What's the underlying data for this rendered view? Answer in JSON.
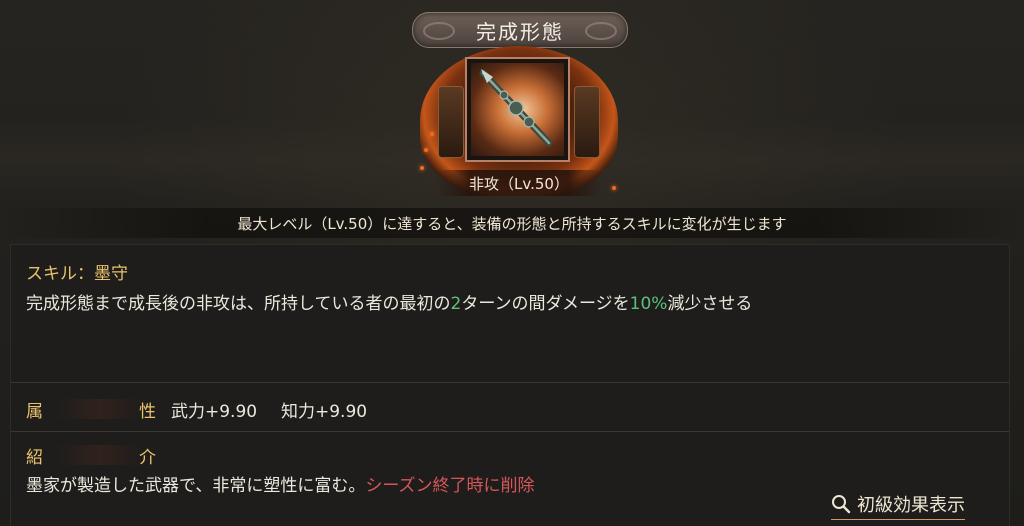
{
  "header": {
    "title": "完成形態"
  },
  "item": {
    "name_level": "非攻（Lv.50）"
  },
  "notice": "最大レベル（Lv.50）に達すると、装備の形態と所持するスキルに変化が生じます",
  "skill": {
    "title": "スキル：墨守",
    "desc_part1": "完成形態まで成長後の非攻は、所持している者の最初の",
    "desc_turns": "2",
    "desc_part2": "ターンの間ダメージを",
    "desc_percent": "10%",
    "desc_part3": "減少させる"
  },
  "attributes": {
    "label_char1": "属",
    "label_char2": "性",
    "stat1": "武力+9.90",
    "stat2": "知力+9.90"
  },
  "intro": {
    "label_char1": "紹",
    "label_char2": "介",
    "text": "墨家が製造した武器で、非常に塑性に富む。",
    "warning": "シーズン終了時に削除"
  },
  "effect_link": {
    "icon": "search-icon",
    "label": "初級効果表示"
  },
  "colors": {
    "accent_gold": "#e9c36c",
    "highlight_green": "#5cc07a",
    "warning_red": "#d5575a"
  }
}
